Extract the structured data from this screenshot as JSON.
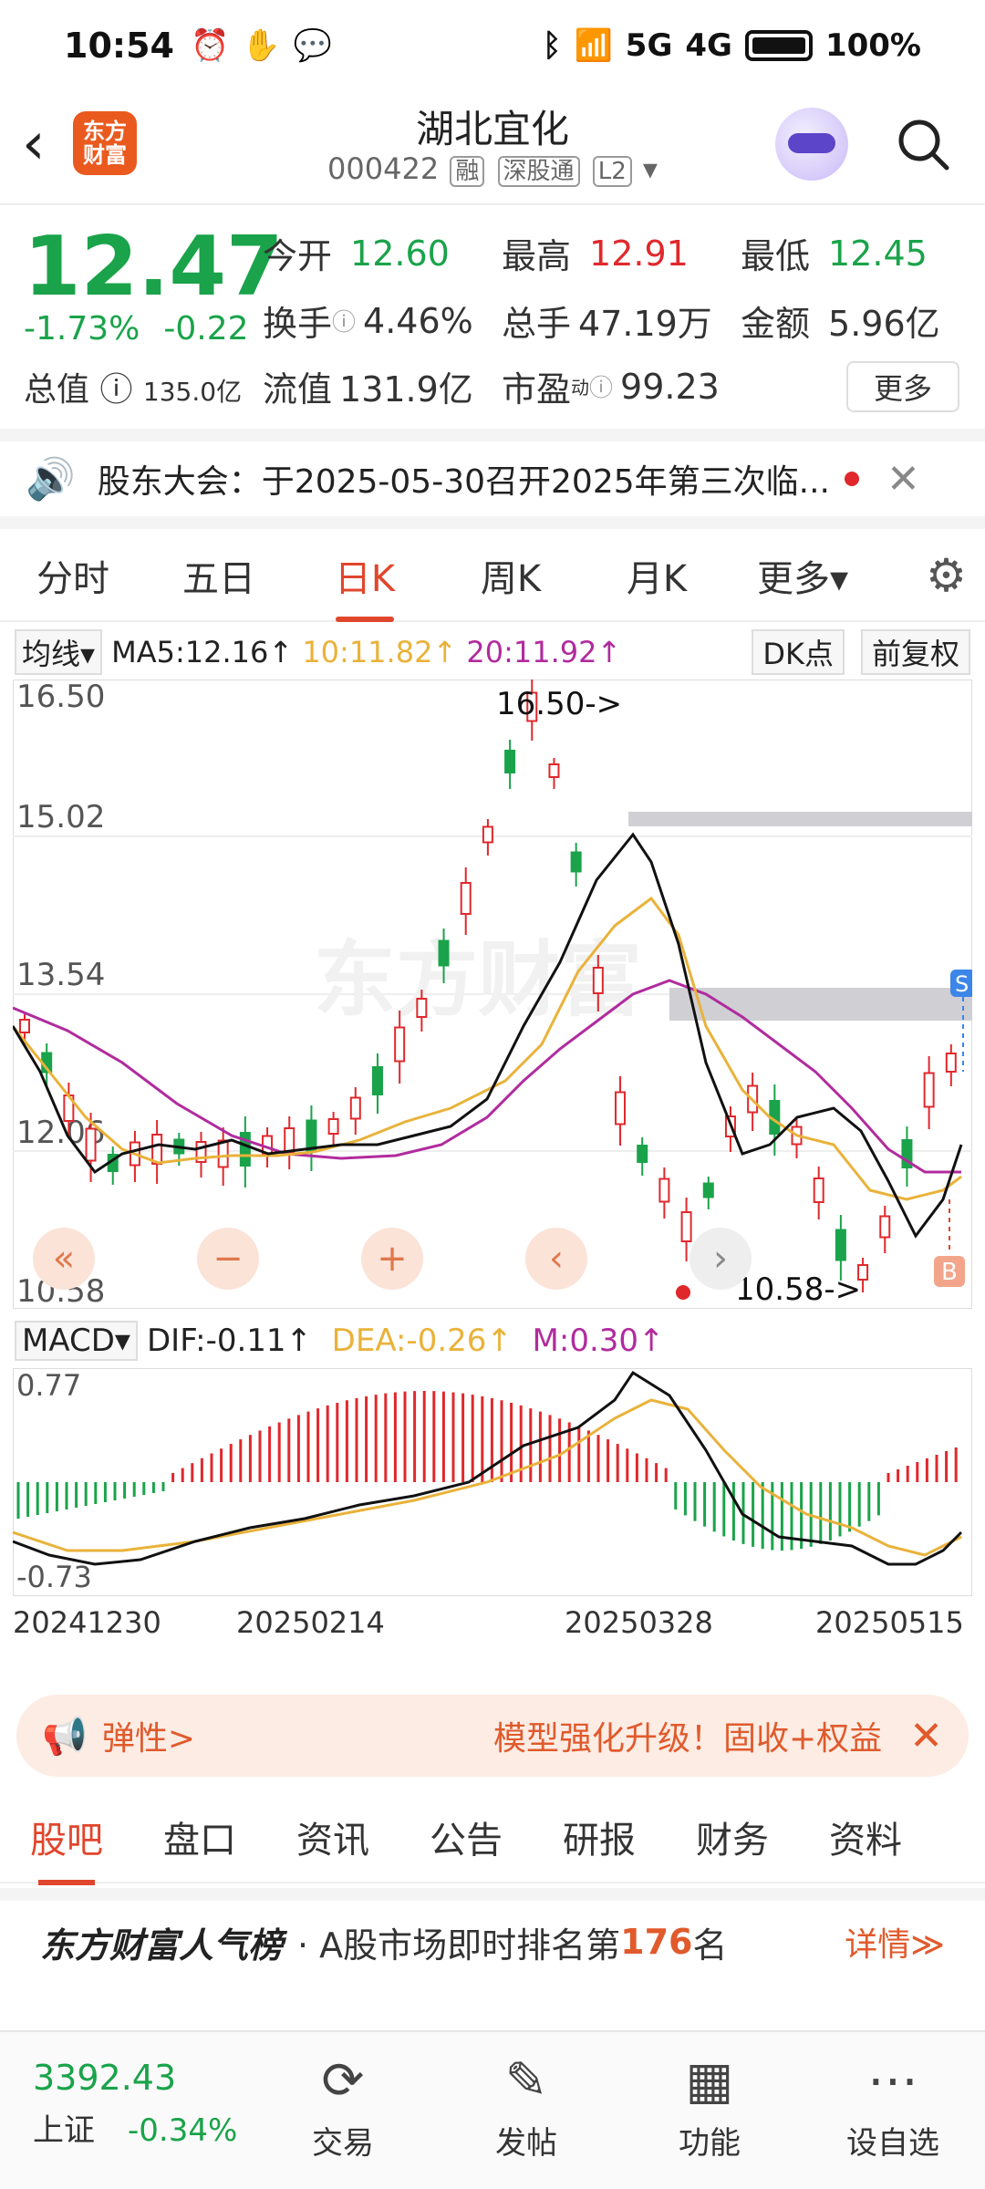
{
  "status": {
    "time": "10:54",
    "signal_5g": "5G",
    "signal_4g": "4G",
    "battery": "100%"
  },
  "nav": {
    "back_icon": "back-arrow",
    "logo": "东方\n财富",
    "title": "湖北宜化",
    "code": "000422",
    "tag1": "融",
    "tag2": "深股通",
    "tag3": "L2"
  },
  "quote": {
    "price": "12.47",
    "change_pct": "-1.73%",
    "change_amt": "-0.22",
    "cap_label": "总值",
    "cap_value": "135.0亿",
    "open_label": "今开",
    "open": "12.60",
    "high_label": "最高",
    "high": "12.91",
    "low_label": "最低",
    "low": "12.45",
    "turnover_label": "换手",
    "turnover": "4.46%",
    "volume_label": "总手",
    "volume": "47.19万",
    "amount_label": "金额",
    "amount": "5.96亿",
    "float_label": "流值",
    "float_value": "131.9亿",
    "pe_label": "市盈",
    "pe_sup": "动",
    "pe": "99.23",
    "more": "更多"
  },
  "notice": {
    "text": "股东大会：于2025-05-30召开2025年第三次临..."
  },
  "ktabs": [
    "分时",
    "五日",
    "日K",
    "周K",
    "月K",
    "更多▾"
  ],
  "ma": {
    "sel": "均线▾",
    "ma5": "MA5:12.16↑",
    "ma10": "10:11.82↑",
    "ma20": "20:11.92↑",
    "dk": "DK点",
    "fq": "前复权"
  },
  "kchart": {
    "y_labels": [
      "16.50",
      "15.02",
      "13.54",
      "12.06",
      "10.58"
    ],
    "max_label": "16.50->",
    "min_label": "10.58->",
    "sell_marker": "S",
    "buy_marker": "B"
  },
  "macd": {
    "sel": "MACD▾",
    "dif": "DIF:-0.11↑",
    "dea": "DEA:-0.26↑",
    "m": "M:0.30↑",
    "top": "0.77",
    "bottom": "-0.73"
  },
  "dates": [
    "20241230",
    "20250214",
    "20250328",
    "20250515"
  ],
  "promo": {
    "left": "弹性>",
    "right": "模型强化升级！固收+权益"
  },
  "btabs": [
    "股吧",
    "盘口",
    "资讯",
    "公告",
    "研报",
    "财务",
    "资料"
  ],
  "rank": {
    "brand": "东方财富人气榜",
    "text": "· A股市场即时排名第",
    "num": "176",
    "suffix": "名",
    "detail": "详情≫"
  },
  "bottom": {
    "index_value": "3392.43",
    "index_name": "上证",
    "index_pct": "-0.34%",
    "trade": "交易",
    "post": "发帖",
    "func": "功能",
    "watch": "设自选"
  },
  "chart_data": {
    "type": "candlestick",
    "y_range": [
      10.58,
      16.5
    ],
    "x_ticks": [
      "20241230",
      "20250214",
      "20250328",
      "20250515"
    ],
    "ma5": 12.16,
    "ma10": 11.82,
    "ma20": 11.92,
    "macd": {
      "dif": -0.11,
      "dea": -0.26,
      "m": 0.3,
      "range": [
        -0.73,
        0.77
      ]
    }
  },
  "colors": {
    "up": "#e0282c",
    "down": "#1aa34a",
    "accent": "#ea5a1f"
  }
}
